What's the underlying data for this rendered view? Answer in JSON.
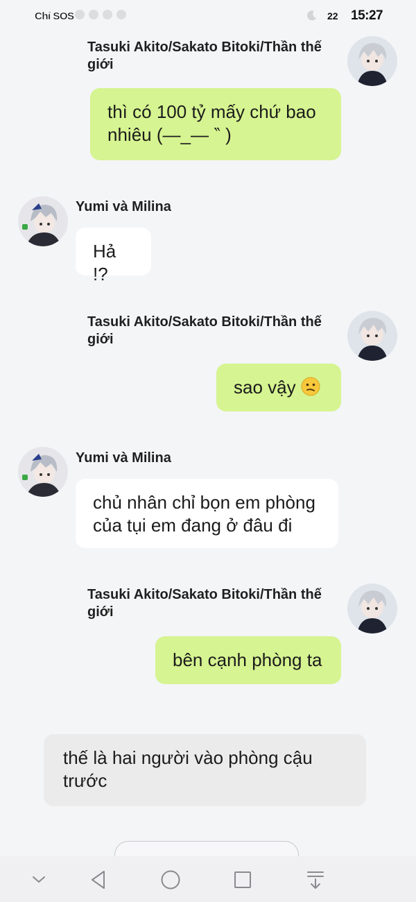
{
  "status_bar": {
    "carrier": "Chỉ SOS",
    "battery": "22",
    "time": "15:27"
  },
  "messages": [
    {
      "sender": "Tasuki Akito/Sakato Bitoki/Thần thế giới",
      "name_line1": "Tasuki Akito/Sakato Bitoki/Thần thế",
      "name_line2": "giới",
      "text_line1": "thì có 100 tỷ mấy chứ bao",
      "text_line2": "nhiêu (—_— ‶ )"
    },
    {
      "sender": "Yumi và Milina",
      "text": "Hả !?"
    },
    {
      "sender": "Tasuki Akito/Sakato Bitoki/Thần thế giới",
      "name_line1": "Tasuki Akito/Sakato Bitoki/Thần thế",
      "name_line2": "giới",
      "text": "sao vậy"
    },
    {
      "sender": "Yumi và Milina",
      "text_line1": "chủ nhân chỉ bọn em phòng",
      "text_line2": "của tụi em đang ở đâu đi"
    },
    {
      "sender": "Tasuki Akito/Sakato Bitoki/Thần thế giới",
      "name_line1": "Tasuki Akito/Sakato Bitoki/Thần thế",
      "name_line2": "giới",
      "text": "bên cạnh phòng ta"
    },
    {
      "sender": "narration",
      "text_line1": "thế là hai người vào phòng cậu",
      "text_line2": "trước"
    }
  ],
  "icons": {
    "user_avatar": "silver-haired-boy-avatar",
    "other_avatar": "yumi-milina-avatar",
    "emoji": "confused-face-emoji",
    "nav": [
      "chevron-down-icon",
      "back-triangle-icon",
      "home-circle-icon",
      "recents-square-icon",
      "collapse-keyboard-icon"
    ]
  },
  "colors": {
    "self_bubble": "#d6f491",
    "other_bubble": "#ffffff",
    "narration_bubble": "#ebebec",
    "background": "#f4f5f7"
  }
}
